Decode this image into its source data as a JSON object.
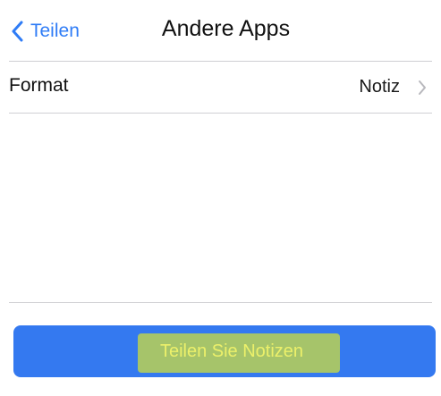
{
  "navbar": {
    "back_label": "Teilen",
    "title": "Andere Apps"
  },
  "icons": {
    "back": "chevron-left-icon",
    "disclosure": "chevron-right-icon"
  },
  "format_row": {
    "label": "Format",
    "value": "Notiz"
  },
  "action": {
    "label": "Teilen Sie Notizen"
  },
  "colors": {
    "accent": "#2f7cf6",
    "button_bg": "#3479f0",
    "highlight": "#a6c46a",
    "button_text": "#ecf06a",
    "separator": "#cfcfd3"
  }
}
